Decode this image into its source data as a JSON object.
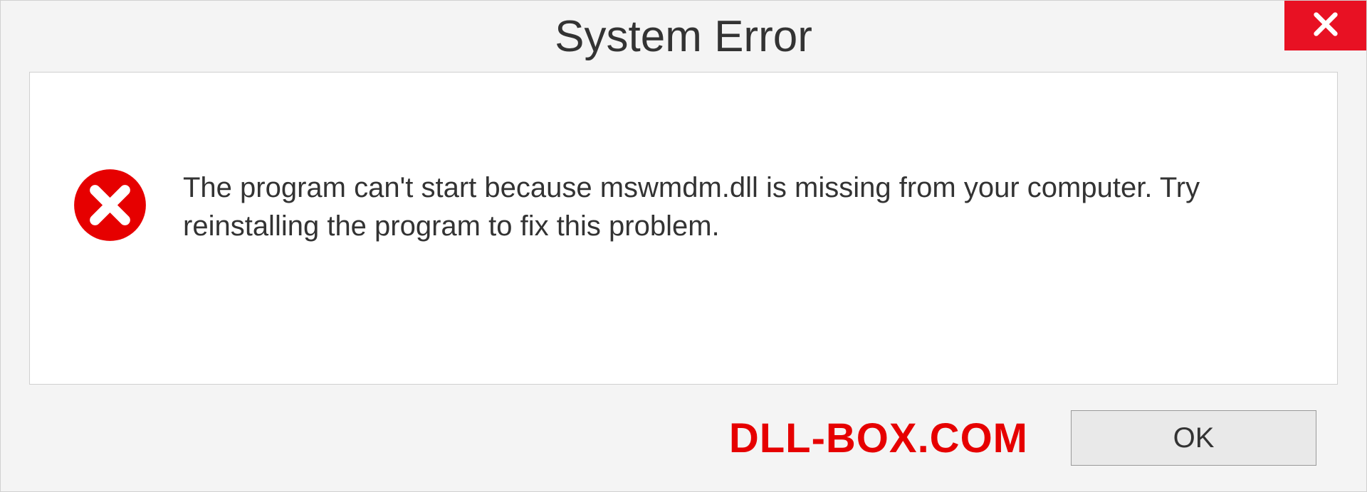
{
  "dialog": {
    "title": "System Error",
    "message": "The program can't start because mswmdm.dll is missing from your computer. Try reinstalling the program to fix this problem.",
    "ok_label": "OK"
  },
  "watermark": "DLL-BOX.COM",
  "colors": {
    "accent_red": "#e81123",
    "watermark_red": "#e60000",
    "background": "#f4f4f4",
    "content_bg": "#ffffff"
  }
}
